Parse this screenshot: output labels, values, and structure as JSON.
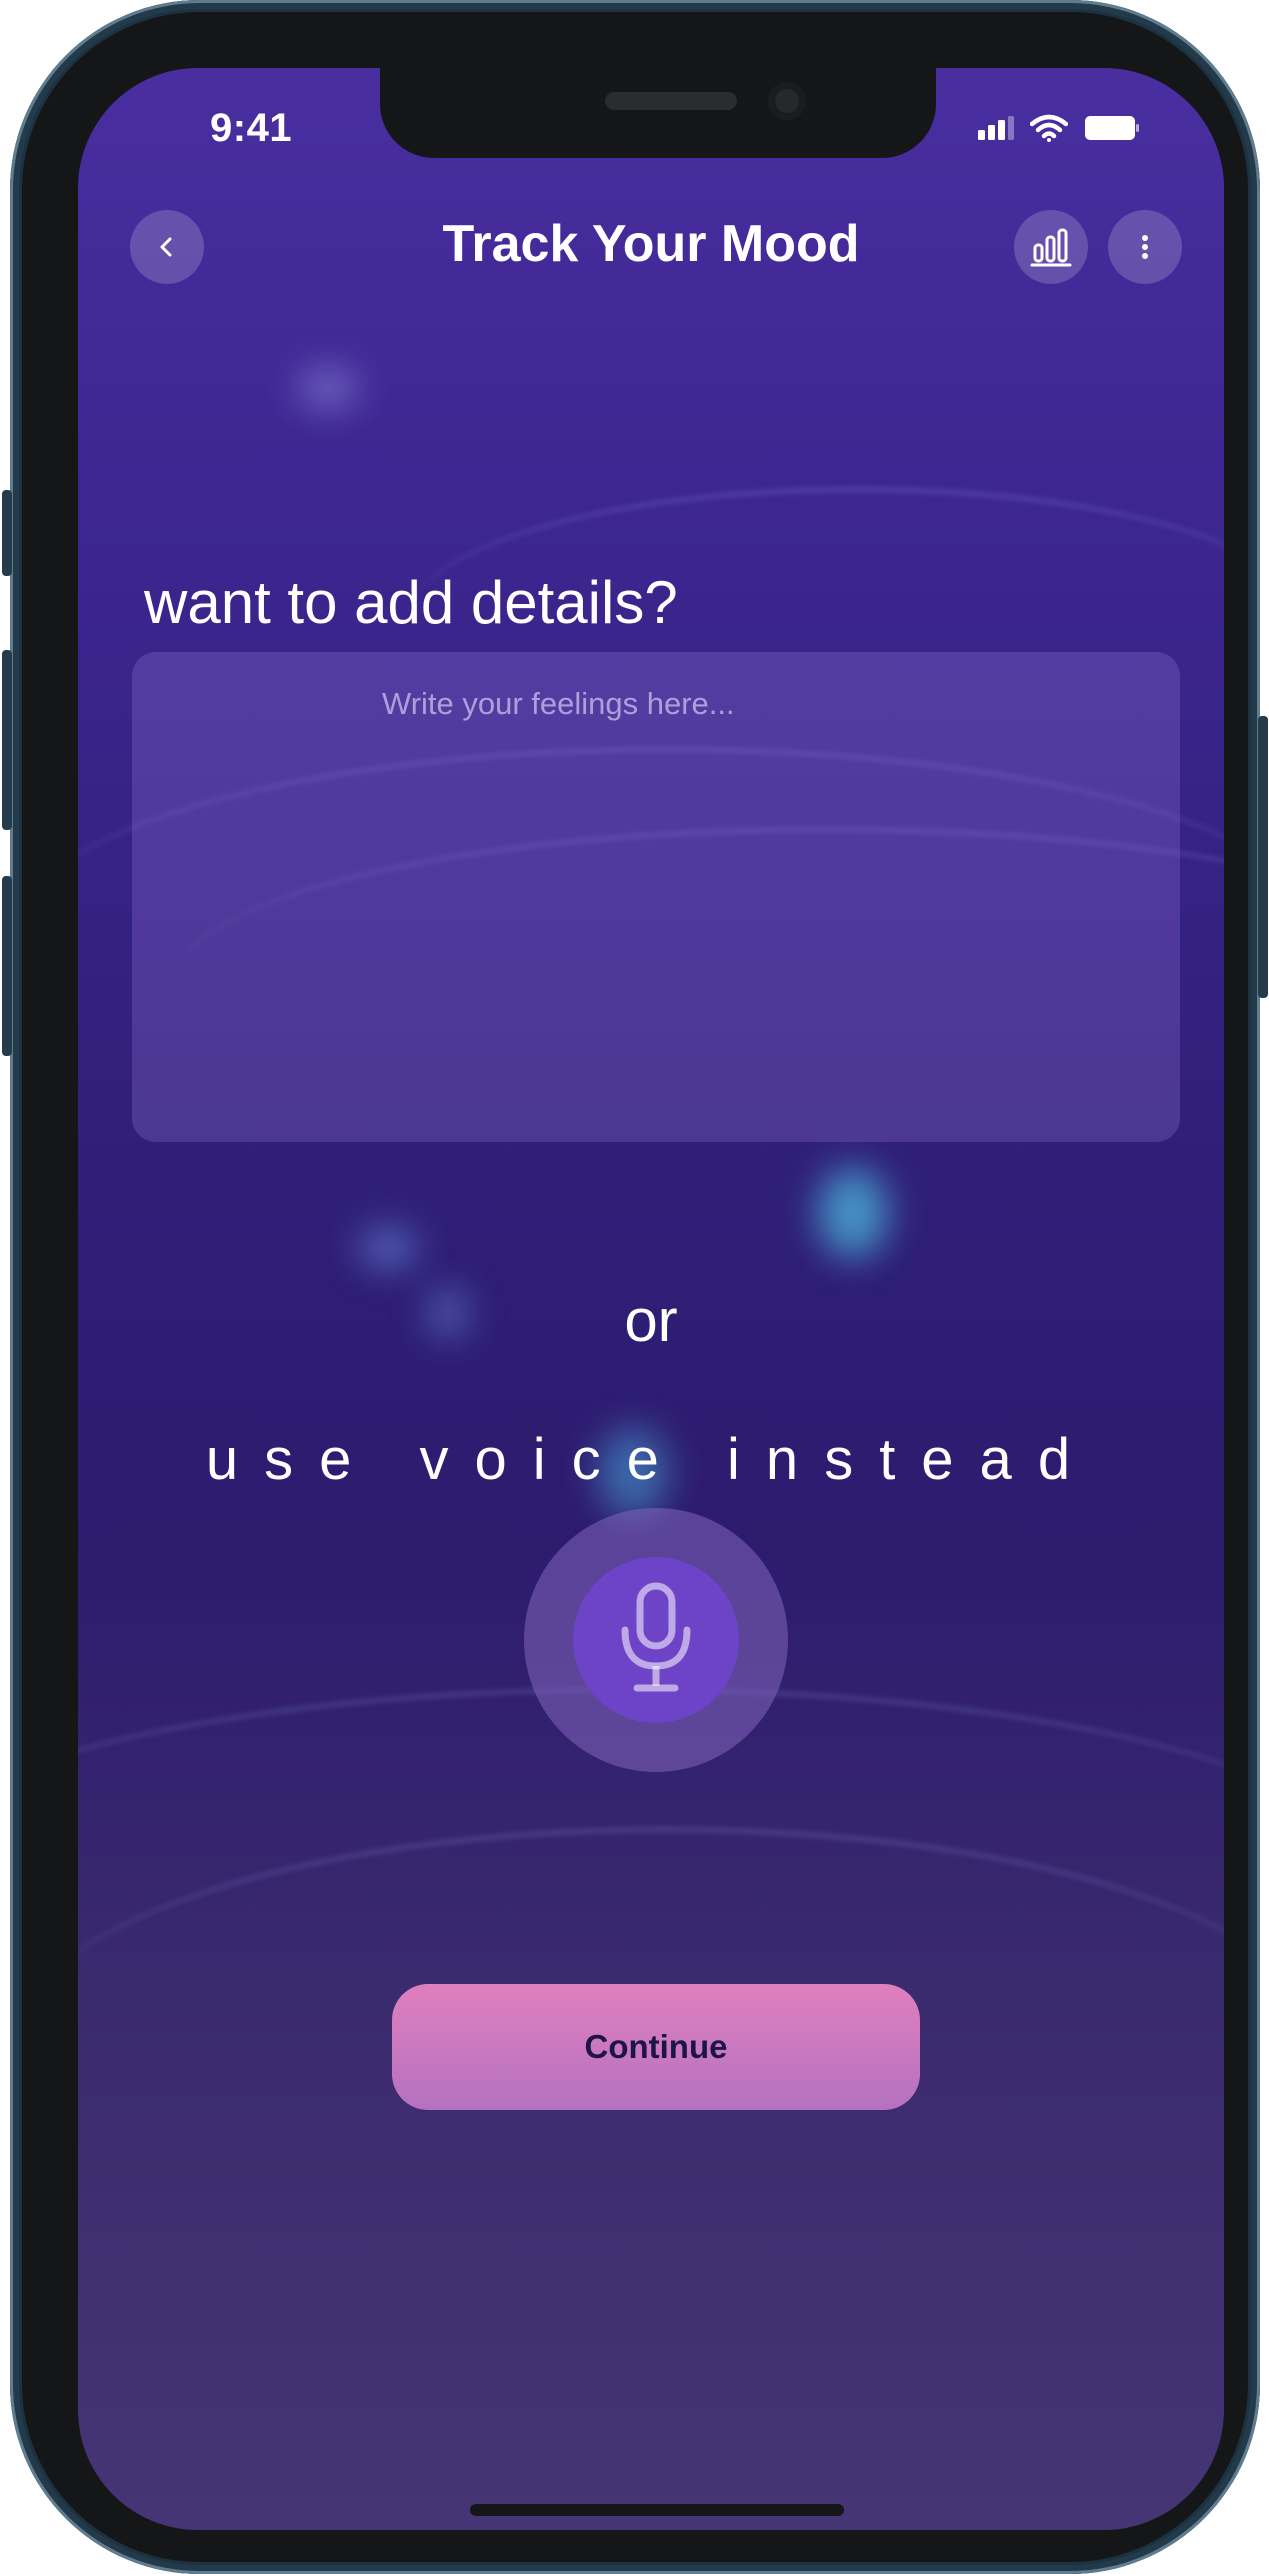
{
  "status_bar": {
    "time": "9:41"
  },
  "header": {
    "title": "Track Your Mood",
    "back_icon": "chevron-left-icon",
    "stats_icon": "bar-chart-icon",
    "menu_icon": "more-vertical-icon"
  },
  "details": {
    "prompt": "want to add details?",
    "placeholder": "Write your feelings here..."
  },
  "divider_text": "or",
  "voice": {
    "label": "use voice instead",
    "icon": "microphone-icon"
  },
  "actions": {
    "continue_label": "Continue"
  },
  "colors": {
    "background_top": "#4a2ea0",
    "background_bottom": "#463575",
    "mic_button": "#6d44c8",
    "continue_button_top": "#e07fbe",
    "continue_button_bottom": "#b472c0",
    "continue_text": "#1d1548"
  }
}
